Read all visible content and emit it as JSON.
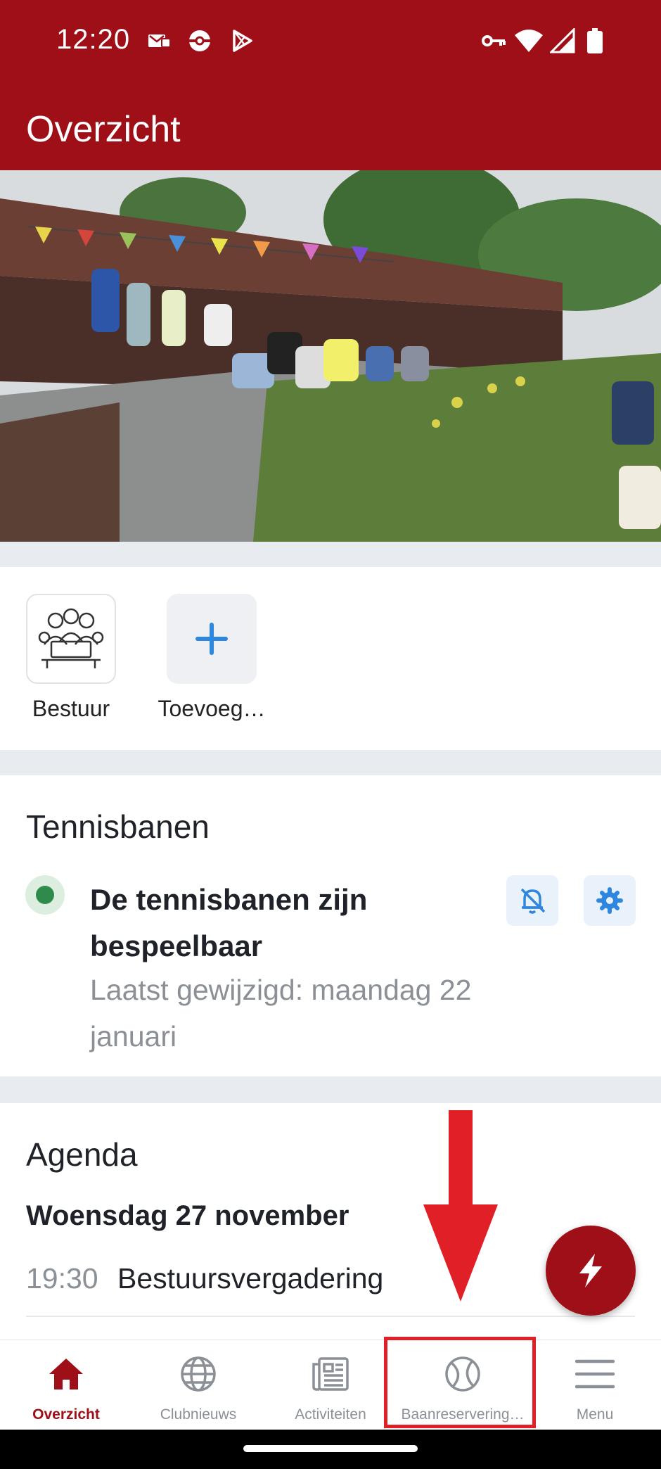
{
  "status_bar": {
    "time": "12:20",
    "left_icons": [
      "mail-badge-icon",
      "pokeball-icon",
      "play-store-icon"
    ],
    "right_icons": [
      "vpn-key-icon",
      "wifi-icon",
      "signal-icon",
      "battery-icon"
    ]
  },
  "app_bar": {
    "title": "Overzicht"
  },
  "hero": {
    "icon": "clubhouse-photo"
  },
  "groups": {
    "items": [
      {
        "label": "Bestuur",
        "icon": "board-people-icon"
      },
      {
        "label": "Toevoeg…",
        "icon": "plus-icon"
      }
    ]
  },
  "courts": {
    "title": "Tennisbanen",
    "status": "De tennisbanen zijn bespeelbaar",
    "changed": "Laatst gewijzigd: maandag 22 januari",
    "status_color": "#2e8b4c",
    "actions": [
      "bell-off-icon",
      "gear-icon"
    ]
  },
  "agenda": {
    "title": "Agenda",
    "date": "Woensdag 27 november",
    "events": [
      {
        "time": "19:30",
        "name": "Bestuursvergadering"
      }
    ]
  },
  "fab": {
    "icon": "lightning-icon"
  },
  "bottom_nav": {
    "items": [
      {
        "label": "Overzicht",
        "icon": "home-icon",
        "active": true
      },
      {
        "label": "Clubnieuws",
        "icon": "globe-icon",
        "active": false
      },
      {
        "label": "Activiteiten",
        "icon": "newspaper-icon",
        "active": false
      },
      {
        "label": "Baanreservering…",
        "icon": "tennis-ball-icon",
        "active": false
      },
      {
        "label": "Menu",
        "icon": "menu-icon",
        "active": false
      }
    ]
  },
  "colors": {
    "brand": "#9e0f18",
    "annotation": "#e11f26",
    "action_blue": "#2f86de"
  }
}
